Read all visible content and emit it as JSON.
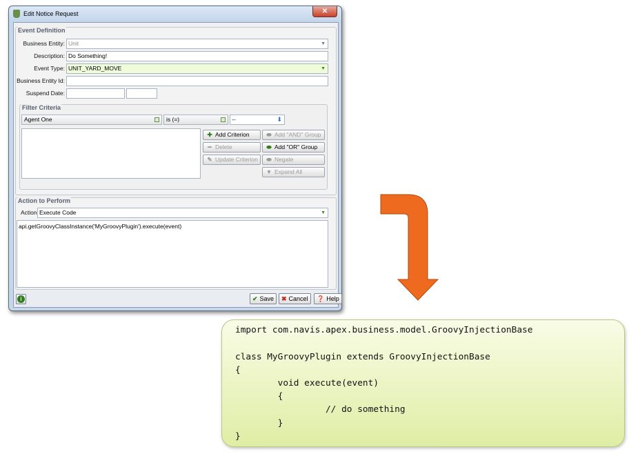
{
  "window": {
    "title": "Edit Notice Request",
    "close_symbol": "✕"
  },
  "event_definition": {
    "title": "Event Definition",
    "business_entity": {
      "label": "Business Entity:",
      "value": "Unit"
    },
    "description": {
      "label": "Description:",
      "value": "Do Something!"
    },
    "event_type": {
      "label": "Event Type:",
      "value": "UNIT_YARD_MOVE"
    },
    "business_entity_id": {
      "label": "Business Entity Id:",
      "value": ""
    },
    "suspend_date": {
      "label": "Suspend Date:",
      "value": "",
      "time": ""
    }
  },
  "filter_criteria": {
    "title": "Filter Criteria",
    "field_value": "Agent One",
    "operator_value": "is (=)",
    "value_value": "--",
    "buttons": {
      "add_criterion": "Add Criterion",
      "delete": "Delete",
      "update_criterion": "Update Criterion",
      "add_and_group": "Add \"AND\" Group",
      "add_or_group": "Add \"OR\" Group",
      "negate": "Negate",
      "expand_all": "Expand All"
    }
  },
  "action": {
    "title": "Action to Perform",
    "label": "Action:",
    "value": "Execute Code",
    "code": "api.getGroovyClassInstance('MyGroovyPlugin').execute(event)"
  },
  "footer": {
    "save": "Save",
    "cancel": "Cancel",
    "help": "Help"
  },
  "code_lines": [
    "import com.navis.apex.business.model.GroovyInjectionBase",
    "class MyGroovyPlugin extends GroovyInjectionBase",
    "{",
    "        void execute(event)",
    "        {",
    "                 // do something",
    "        }",
    "}"
  ],
  "colors": {
    "arrow": "#ee6a1e",
    "code_bg": "#e8f2b8",
    "event_type_bg": "#f0fbd9"
  }
}
